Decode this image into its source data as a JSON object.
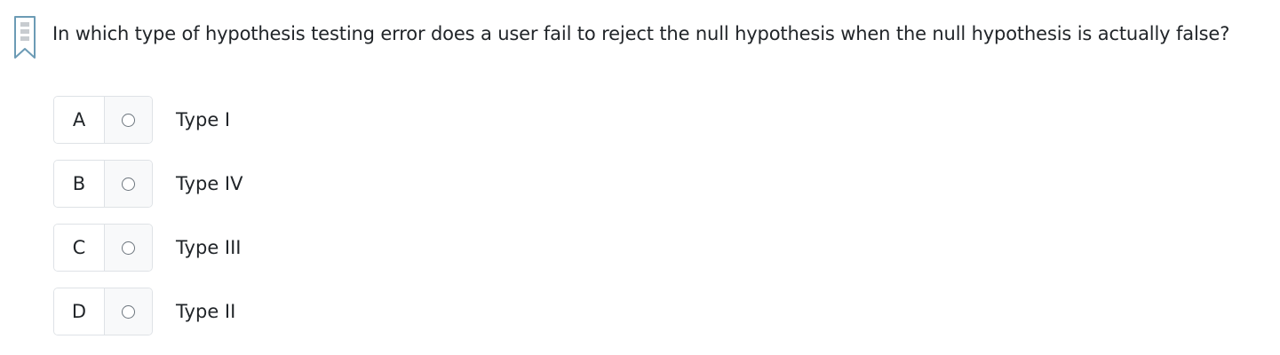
{
  "question": {
    "text": "In which type of hypothesis testing error does a user fail to reject the null hypothesis when the null hypothesis is actually false?",
    "bookmark_icon": "bookmark-icon"
  },
  "options": [
    {
      "letter": "A",
      "text": "Type I",
      "selected": false
    },
    {
      "letter": "B",
      "text": "Type IV",
      "selected": false
    },
    {
      "letter": "C",
      "text": "Type III",
      "selected": false
    },
    {
      "letter": "D",
      "text": "Type II",
      "selected": false
    }
  ],
  "colors": {
    "border": "#dee2e6",
    "radio_bg": "#f8f9fa",
    "bookmark": "#6c9bb5",
    "text": "#212529"
  }
}
